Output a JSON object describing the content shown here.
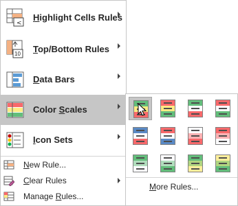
{
  "menu": {
    "items": [
      {
        "label": "Highlight Cells Rules",
        "mnemonic": "H",
        "rest": "ighlight Cells Rules",
        "icon": "highlight-cells-rules-icon"
      },
      {
        "label": "Top/Bottom Rules",
        "mnemonic": "T",
        "rest": "op/Bottom Rules",
        "icon": "top-bottom-rules-icon",
        "icon_text_top": "10"
      },
      {
        "label": "Data Bars",
        "mnemonic": "D",
        "rest": "ata Bars",
        "icon": "data-bars-icon"
      },
      {
        "label": "Color Scales",
        "mnemonic": "S",
        "pre": "Color ",
        "rest": "cales",
        "icon": "color-scales-icon",
        "active": true
      },
      {
        "label": "Icon Sets",
        "mnemonic": "I",
        "rest": "con Sets",
        "icon": "icon-sets-icon"
      }
    ],
    "small_items": [
      {
        "label": "New Rule...",
        "pre": "",
        "mnemonic": "N",
        "rest": "ew Rule...",
        "icon": "new-rule-icon"
      },
      {
        "label": "Clear Rules",
        "pre": "",
        "mnemonic": "C",
        "rest": "lear Rules",
        "icon": "clear-rules-icon",
        "submenu": true
      },
      {
        "label": "Manage Rules...",
        "pre": "",
        "mnemonic": "R",
        "pre2": "Manage ",
        "rest": "ules...",
        "icon": "manage-rules-icon"
      }
    ]
  },
  "gallery": {
    "more_rules_mnemonic": "M",
    "more_rules_rest": "ore Rules...",
    "tiles": [
      {
        "name": "green-yellow-red",
        "colors": [
          "#63be7b",
          "#ffeb84",
          "#f8696b"
        ],
        "selected": true
      },
      {
        "name": "red-yellow-green",
        "colors": [
          "#f8696b",
          "#ffeb84",
          "#63be7b"
        ]
      },
      {
        "name": "green-white-red",
        "colors": [
          "#63be7b",
          "#fcfcff",
          "#f8696b"
        ]
      },
      {
        "name": "red-white-green",
        "colors": [
          "#f8696b",
          "#fcfcff",
          "#63be7b"
        ]
      },
      {
        "name": "blue-white-red",
        "colors": [
          "#5a8ac6",
          "#fcfcff",
          "#f8696b"
        ]
      },
      {
        "name": "red-white-blue",
        "colors": [
          "#f8696b",
          "#fcfcff",
          "#5a8ac6"
        ]
      },
      {
        "name": "white-red",
        "colors": [
          "#fcfcff",
          "#fbb2b4",
          "#f8696b"
        ]
      },
      {
        "name": "red-white",
        "colors": [
          "#f8696b",
          "#fbb2b4",
          "#fcfcff"
        ]
      },
      {
        "name": "green-white",
        "colors": [
          "#63be7b",
          "#b1ddbd",
          "#fcfcff"
        ]
      },
      {
        "name": "white-green",
        "colors": [
          "#fcfcff",
          "#b1ddbd",
          "#63be7b"
        ]
      },
      {
        "name": "green-yellow",
        "colors": [
          "#63be7b",
          "#b1d580",
          "#ffef9c"
        ]
      },
      {
        "name": "yellow-green",
        "colors": [
          "#ffef9c",
          "#b1d580",
          "#63be7b"
        ]
      }
    ]
  },
  "colors": {
    "active_bg": "#c6c6c6",
    "border": "#c6c6c6"
  }
}
